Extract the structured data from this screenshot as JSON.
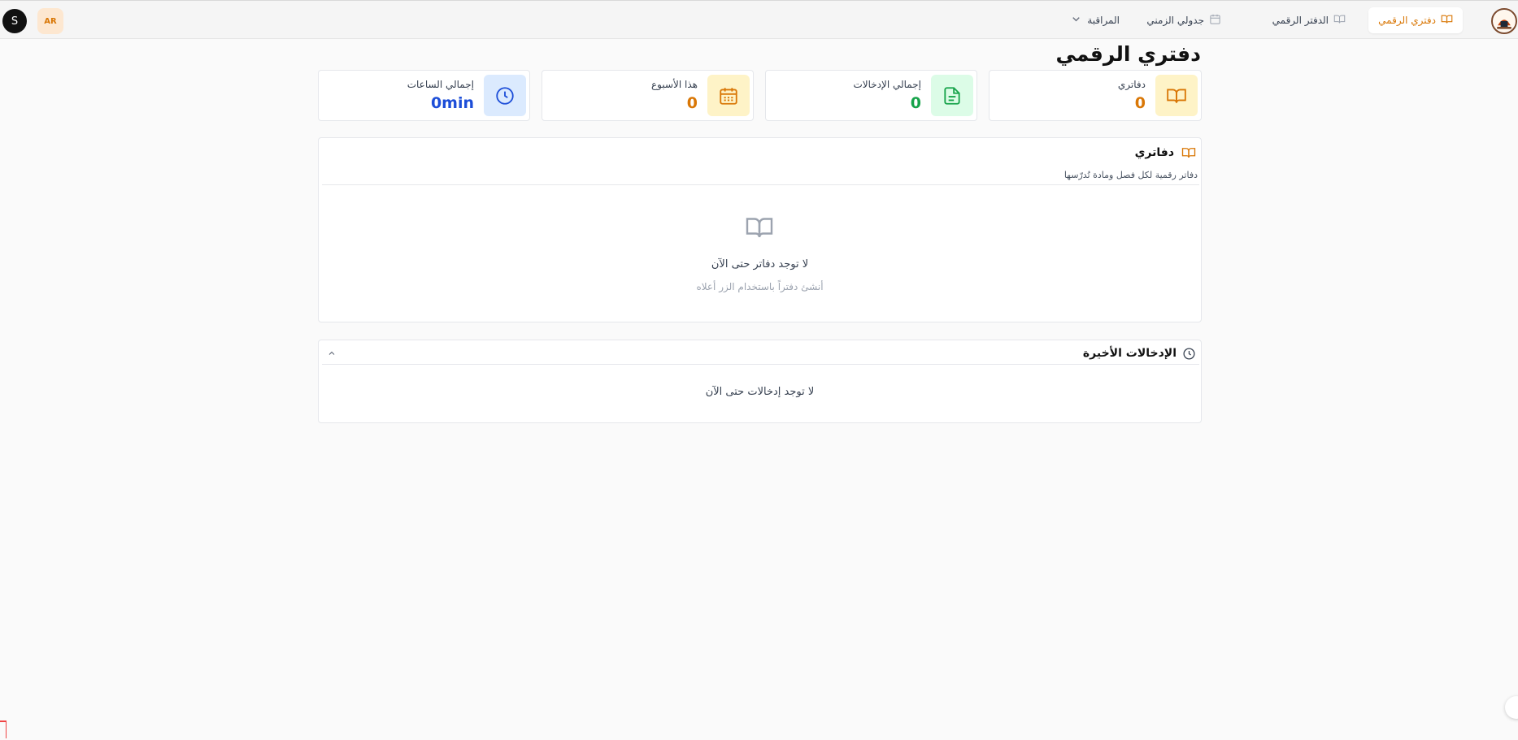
{
  "header": {
    "user_initial": "S",
    "language_code": "AR",
    "nav": {
      "my_notebooks": "دفتري الرقمي",
      "digital_notebook": "الدفتر الرقمي",
      "my_schedule": "جدولي الزمني",
      "monitoring": "المراقبة"
    },
    "accent_color": "#d97706"
  },
  "page": {
    "title": "دفتري الرقمي"
  },
  "stats": [
    {
      "label": "دفاتري",
      "value": "0",
      "icon": "book-open-icon",
      "color": "#d97706"
    },
    {
      "label": "إجمالي الإدخالات",
      "value": "0",
      "icon": "document-icon",
      "color": "#16a34a"
    },
    {
      "label": "هذا الأسبوع",
      "value": "0",
      "icon": "calendar-icon",
      "color": "#d97706"
    },
    {
      "label": "إجمالي الساعات",
      "value": "0min",
      "icon": "clock-icon",
      "color": "#1d4ed8"
    }
  ],
  "notebooks_panel": {
    "title": "دفاتري",
    "subtitle": "دفاتر رقمية لكل فصل ومادة تُدرّسها",
    "empty_title": "لا توجد دفاتر حتى الآن",
    "empty_subtitle": "أنشئ دفتراً باستخدام الزر أعلاه"
  },
  "recent_panel": {
    "title": "الإدخالات الأخيرة",
    "empty_text": "لا توجد إدخالات حتى الآن"
  }
}
